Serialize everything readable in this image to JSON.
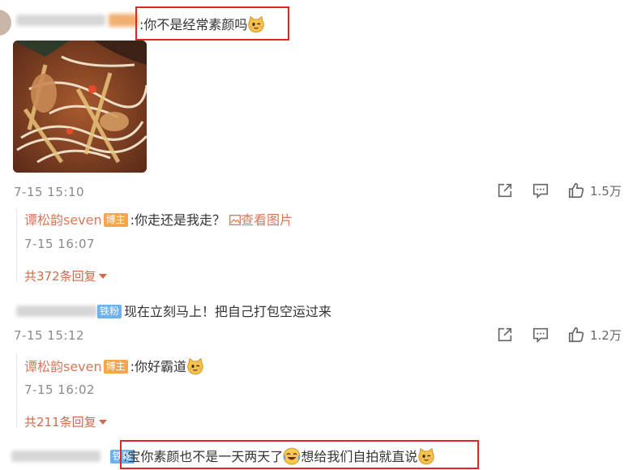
{
  "comment1": {
    "text": ":你不是经常素颜吗",
    "time": "7-15 15:10",
    "likes": "1.5万",
    "reply": {
      "name": "谭松韵seven",
      "badge": "博主",
      "text": ":你走还是我走？",
      "view_image": "查看图片",
      "time": "7-15 16:07"
    },
    "reply_count": "共372条回复"
  },
  "comment2": {
    "badge": "铁粉",
    "text": "现在立刻马上！把自己打包空运过来",
    "time": "7-15 15:12",
    "likes": "1.2万",
    "reply": {
      "name": "谭松韵seven",
      "badge": "博主",
      "text": ":你好霸道",
      "time": "7-15 16:02"
    },
    "reply_count": "共211条回复"
  },
  "comment3": {
    "badge": "铁粉",
    "text_a": ":宝你素颜也不是一天两天了",
    "text_b": "想给我们自拍就直说"
  },
  "colors": {
    "highlight": "#e0242b",
    "badge_blogger": "#f3a64a",
    "badge_fan": "#6fb1ea",
    "reply_name": "#d8785a"
  }
}
